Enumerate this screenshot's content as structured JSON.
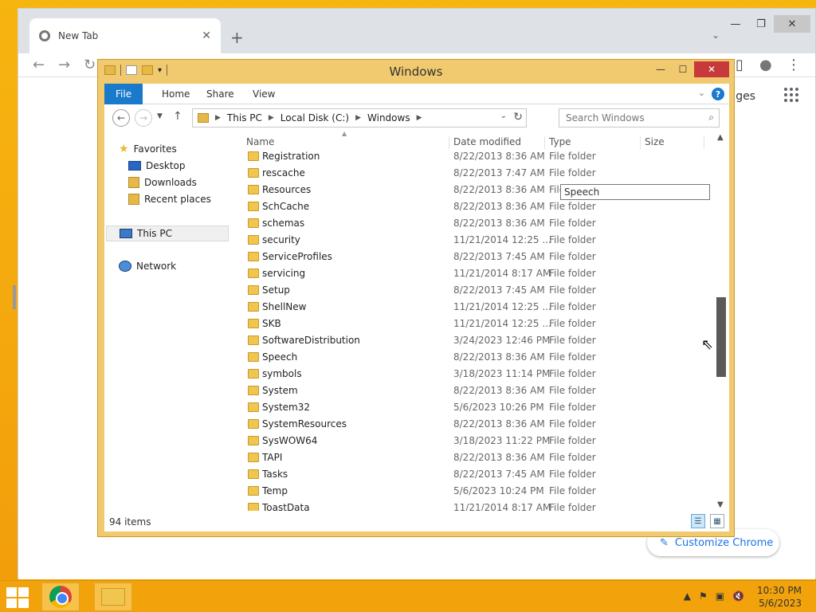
{
  "chrome": {
    "tab_title": "New Tab",
    "tab_close": "✕",
    "new_tab": "+",
    "partial_link": "ages",
    "customize_label": "Customize Chrome"
  },
  "explorer": {
    "title": "Windows",
    "ribbon": {
      "tabs": [
        "File",
        "Home",
        "Share",
        "View"
      ],
      "help": "?"
    },
    "address": {
      "segments": [
        "This PC",
        "Local Disk (C:)",
        "Windows"
      ]
    },
    "search": {
      "placeholder": "Search Windows"
    },
    "nav_pane": {
      "favorites": "Favorites",
      "desktop": "Desktop",
      "downloads": "Downloads",
      "recent": "Recent places",
      "this_pc": "This PC",
      "network": "Network"
    },
    "columns": {
      "name": "Name",
      "date": "Date modified",
      "type": "Type",
      "size": "Size"
    },
    "files": [
      {
        "name": "Registration",
        "date": "8/22/2013 8:36 AM",
        "type": "File folder"
      },
      {
        "name": "rescache",
        "date": "8/22/2013 7:47 AM",
        "type": "File folder"
      },
      {
        "name": "Resources",
        "date": "8/22/2013 8:36 AM",
        "type": "File folder"
      },
      {
        "name": "SchCache",
        "date": "8/22/2013 8:36 AM",
        "type": "File folder"
      },
      {
        "name": "schemas",
        "date": "8/22/2013 8:36 AM",
        "type": "File folder"
      },
      {
        "name": "security",
        "date": "11/21/2014 12:25 ...",
        "type": "File folder"
      },
      {
        "name": "ServiceProfiles",
        "date": "8/22/2013 7:45 AM",
        "type": "File folder"
      },
      {
        "name": "servicing",
        "date": "11/21/2014 8:17 AM",
        "type": "File folder"
      },
      {
        "name": "Setup",
        "date": "8/22/2013 7:45 AM",
        "type": "File folder"
      },
      {
        "name": "ShellNew",
        "date": "11/21/2014 12:25 ...",
        "type": "File folder"
      },
      {
        "name": "SKB",
        "date": "11/21/2014 12:25 ...",
        "type": "File folder"
      },
      {
        "name": "SoftwareDistribution",
        "date": "3/24/2023 12:46 PM",
        "type": "File folder"
      },
      {
        "name": "Speech",
        "date": "8/22/2013 8:36 AM",
        "type": "File folder"
      },
      {
        "name": "symbols",
        "date": "3/18/2023 11:14 PM",
        "type": "File folder"
      },
      {
        "name": "System",
        "date": "8/22/2013 8:36 AM",
        "type": "File folder"
      },
      {
        "name": "System32",
        "date": "5/6/2023 10:26 PM",
        "type": "File folder"
      },
      {
        "name": "SystemResources",
        "date": "8/22/2013 8:36 AM",
        "type": "File folder"
      },
      {
        "name": "SysWOW64",
        "date": "3/18/2023 11:22 PM",
        "type": "File folder"
      },
      {
        "name": "TAPI",
        "date": "8/22/2013 8:36 AM",
        "type": "File folder"
      },
      {
        "name": "Tasks",
        "date": "8/22/2013 7:45 AM",
        "type": "File folder"
      },
      {
        "name": "Temp",
        "date": "5/6/2023 10:24 PM",
        "type": "File folder"
      },
      {
        "name": "ToastData",
        "date": "11/21/2014 8:17 AM",
        "type": "File folder"
      }
    ],
    "tooltip": "Speech",
    "status": "94 items"
  },
  "taskbar": {
    "time": "10:30 PM",
    "date": "5/6/2023"
  }
}
